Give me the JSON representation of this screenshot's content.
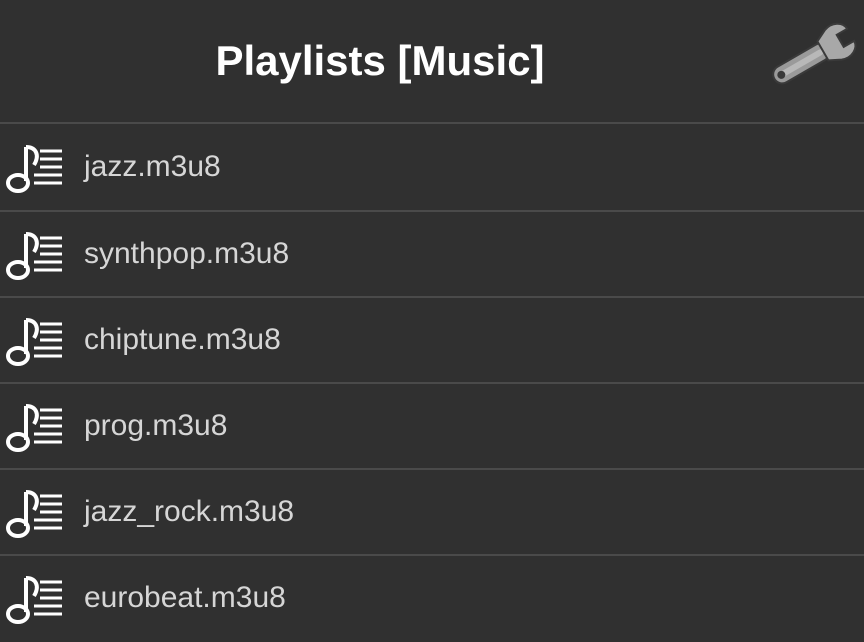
{
  "header": {
    "title": "Playlists [Music]",
    "settings_icon": "wrench-icon"
  },
  "playlists": {
    "item_icon": "music-playlist-icon",
    "items": [
      {
        "label": "jazz.m3u8"
      },
      {
        "label": "synthpop.m3u8"
      },
      {
        "label": "chiptune.m3u8"
      },
      {
        "label": "prog.m3u8"
      },
      {
        "label": "jazz_rock.m3u8"
      },
      {
        "label": "eurobeat.m3u8"
      }
    ]
  },
  "colors": {
    "background": "#303030",
    "divider": "#4a4a4a",
    "title": "#ffffff",
    "item_text": "#d6d6d6"
  }
}
